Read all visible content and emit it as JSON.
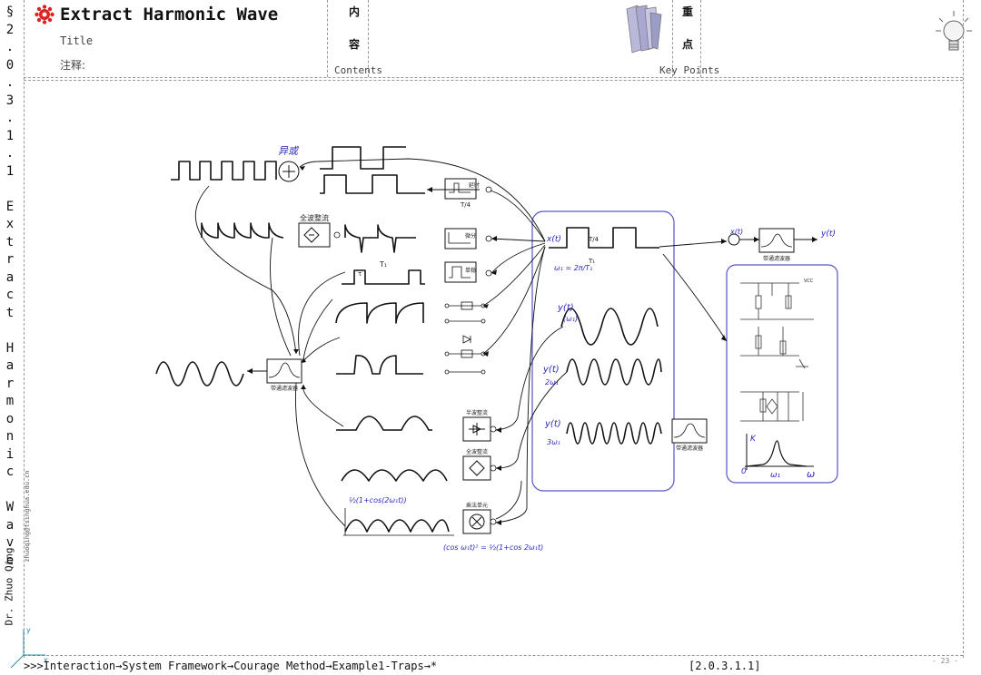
{
  "sidebar": {
    "vertical_title": [
      "§",
      "2",
      ".",
      "0",
      ".",
      "3",
      ".",
      "1",
      ".",
      "1",
      " ",
      "E",
      "x",
      "t",
      "r",
      "a",
      "c",
      "t",
      " ",
      "H",
      "a",
      "r",
      "m",
      "o",
      "n",
      "i",
      "c",
      " ",
      "W",
      "a",
      "v",
      "e"
    ],
    "author": "Dr. Zhuo Qing",
    "email": "zhuoqing@tsinghua.edu.cn"
  },
  "header": {
    "title": "Extract Harmonic Wave",
    "title_caption": "Title",
    "note_label": "注释:",
    "contents_char1": "内",
    "contents_char2": "容",
    "contents_caption": "Contents",
    "keypoints_char1": "重",
    "keypoints_char2": "点",
    "keypoints_caption": "Key Points",
    "book-icon": "book-icon",
    "bulb-icon": "lightbulb-icon"
  },
  "diagram": {
    "adder_label": "异或",
    "fullwave_label": "全波整流",
    "delay_label": "延时",
    "delay_sub": "T/4",
    "diff_label": "微分",
    "integ_label": "单稳",
    "period_T1": "T₁",
    "tau": "τ",
    "input_label": "x(t)",
    "input_T4": "T/4",
    "input_T1": "T₁",
    "omega_eq": "ω₁ = 2π/T₁",
    "y1_label": "y(t)",
    "y1_sub": "(ω₁)",
    "y2_label": "y(t)",
    "y2_sub": "2ω₁",
    "y3_label": "y(t)",
    "y3_sub": "3ω₁",
    "bpf_label": "带通滤波器",
    "bpf_left_label": "带通滤波器",
    "bpf_right_label": "带通滤波器",
    "halfwave_label": "半波整流",
    "fullwave2_label": "全波整流",
    "mult_label": "乘法单元",
    "cos_top": "½(1+cos(2ω₁t))",
    "cos_eq": "(cos ω₁t)² = ½(1+cos 2ω₁t)",
    "rt_x": "x(t)",
    "rt_y": "y(t)",
    "vcc": "VCC",
    "resp_K": "K",
    "resp_0": "0",
    "resp_w1": "ω₁",
    "resp_w": "ω"
  },
  "footer": {
    "path": ">>>Interaction→System Framework→Courage Method→Example1-Traps→*",
    "code": "[2.0.3.1.1]",
    "page": "- 23 -"
  }
}
